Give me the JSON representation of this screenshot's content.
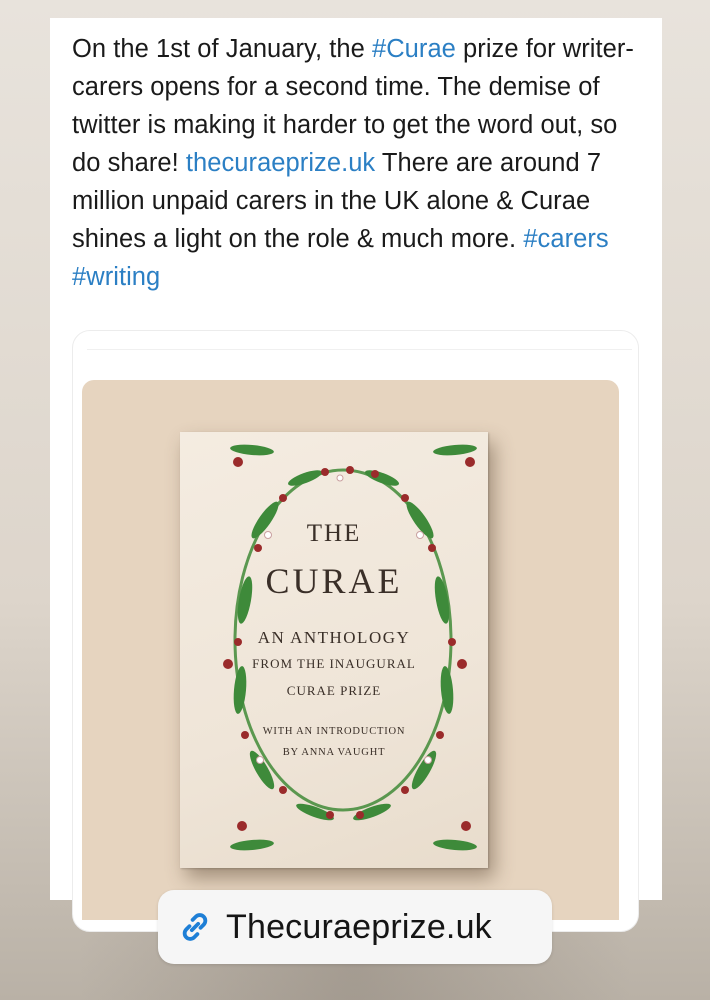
{
  "post": {
    "text_1": "On the 1st of January, the ",
    "hashtag_curae": "#Curae",
    "text_2": " prize for writer-carers opens for a second time. The demise of twitter is making it harder to get the word out, so do share! ",
    "link_site": "thecuraeprize.uk",
    "text_3": " There are around 7 million unpaid carers in the UK alone & Curae shines a light on the role & much more. ",
    "hashtag_carers": "#carers",
    "text_4": " ",
    "hashtag_writing": "#writing"
  },
  "book": {
    "line_the": "THE",
    "line_curae": "CURAE",
    "line_anthology": "AN ANTHOLOGY",
    "line_from": "FROM THE INAUGURAL",
    "line_prize": "CURAE PRIZE",
    "line_intro": "WITH AN INTRODUCTION",
    "line_by": "BY ANNA VAUGHT"
  },
  "link_sticker": {
    "label": "Thecuraeprize.uk",
    "icon": "link-icon"
  },
  "colors": {
    "link_blue": "#2b7fc4",
    "image_background": "#e6d4bf",
    "book_cover": "#f4ece1",
    "leaf_green": "#3e8a3a",
    "flower_red": "#9a2b2b",
    "sticker_icon_blue": "#1e7fd6"
  }
}
